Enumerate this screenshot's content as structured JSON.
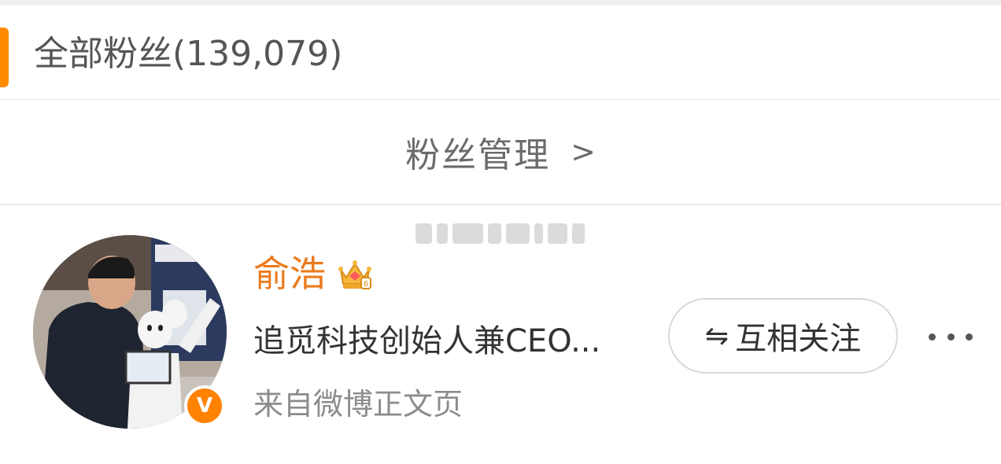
{
  "section_header": {
    "title": "全部粉丝(139,079)",
    "accent_color": "#ff8a00"
  },
  "fan_management": {
    "label": "粉丝管理",
    "chevron": ">"
  },
  "fan_list": {
    "items": [
      {
        "name": "俞浩",
        "name_color": "#eb7b1d",
        "vip_icon": "vip-crown-icon",
        "verified_icon": "verified-v-icon",
        "verified_mark": "V",
        "description": "追觅科技创始人兼CEO...",
        "source": "来自微博正文页",
        "follow_button": {
          "icon": "⇋",
          "label": "互相关注"
        },
        "more_icon": "more-dots-icon"
      }
    ]
  }
}
